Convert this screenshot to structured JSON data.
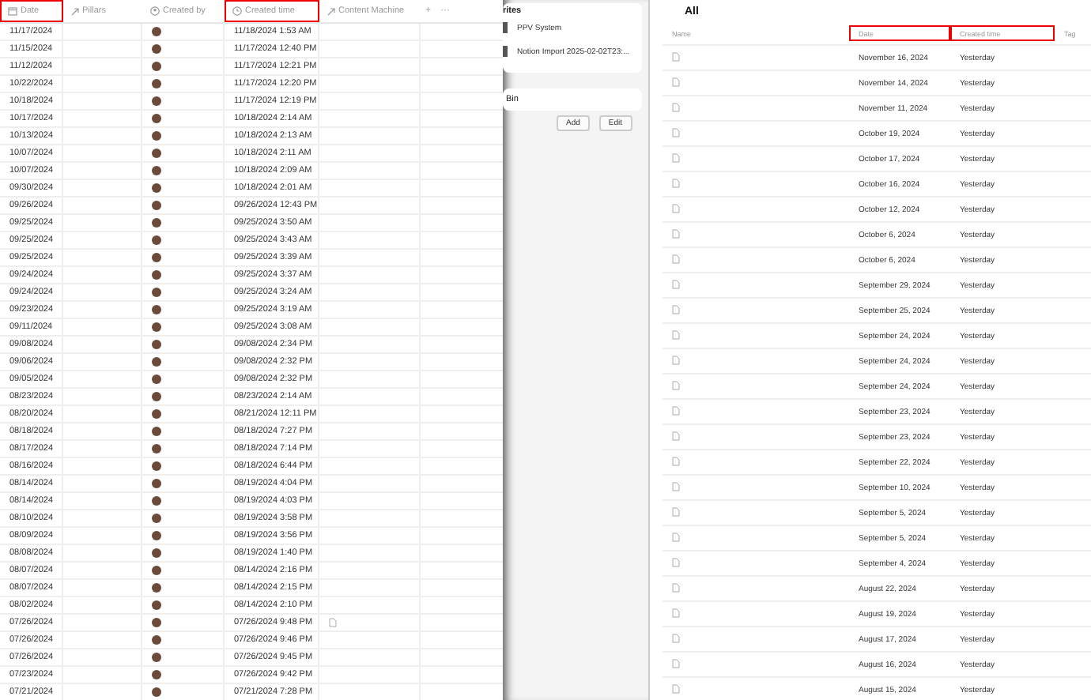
{
  "table": {
    "columns": [
      {
        "label": "Date",
        "highlighted": true
      },
      {
        "label": "Pillars",
        "highlighted": false
      },
      {
        "label": "Created by",
        "highlighted": false
      },
      {
        "label": "Created time",
        "highlighted": true
      },
      {
        "label": "Content Machine",
        "highlighted": false
      }
    ],
    "add_button": "+",
    "more_button": "···",
    "rows": [
      {
        "date": "11/17/2024",
        "created_time": "11/18/2024 1:53 AM",
        "page_link": false
      },
      {
        "date": "11/15/2024",
        "created_time": "11/17/2024 12:40 PM",
        "page_link": false
      },
      {
        "date": "11/12/2024",
        "created_time": "11/17/2024 12:21 PM",
        "page_link": false
      },
      {
        "date": "10/22/2024",
        "created_time": "11/17/2024 12:20 PM",
        "page_link": false
      },
      {
        "date": "10/18/2024",
        "created_time": "11/17/2024 12:19 PM",
        "page_link": false
      },
      {
        "date": "10/17/2024",
        "created_time": "10/18/2024 2:14 AM",
        "page_link": false
      },
      {
        "date": "10/13/2024",
        "created_time": "10/18/2024 2:13 AM",
        "page_link": false
      },
      {
        "date": "10/07/2024",
        "created_time": "10/18/2024 2:11 AM",
        "page_link": false
      },
      {
        "date": "10/07/2024",
        "created_time": "10/18/2024 2:09 AM",
        "page_link": false
      },
      {
        "date": "09/30/2024",
        "created_time": "10/18/2024 2:01 AM",
        "page_link": false
      },
      {
        "date": "09/26/2024",
        "created_time": "09/26/2024 12:43 PM",
        "page_link": false
      },
      {
        "date": "09/25/2024",
        "created_time": "09/25/2024 3:50 AM",
        "page_link": false
      },
      {
        "date": "09/25/2024",
        "created_time": "09/25/2024 3:43 AM",
        "page_link": false
      },
      {
        "date": "09/25/2024",
        "created_time": "09/25/2024 3:39 AM",
        "page_link": false
      },
      {
        "date": "09/24/2024",
        "created_time": "09/25/2024 3:37 AM",
        "page_link": false
      },
      {
        "date": "09/24/2024",
        "created_time": "09/25/2024 3:24 AM",
        "page_link": false
      },
      {
        "date": "09/23/2024",
        "created_time": "09/25/2024 3:19 AM",
        "page_link": false
      },
      {
        "date": "09/11/2024",
        "created_time": "09/25/2024 3:08 AM",
        "page_link": false
      },
      {
        "date": "09/08/2024",
        "created_time": "09/08/2024 2:34 PM",
        "page_link": false
      },
      {
        "date": "09/06/2024",
        "created_time": "09/08/2024 2:32 PM",
        "page_link": false
      },
      {
        "date": "09/05/2024",
        "created_time": "09/08/2024 2:32 PM",
        "page_link": false
      },
      {
        "date": "08/23/2024",
        "created_time": "08/23/2024 2:14 AM",
        "page_link": false
      },
      {
        "date": "08/20/2024",
        "created_time": "08/21/2024 12:11 PM",
        "page_link": false
      },
      {
        "date": "08/18/2024",
        "created_time": "08/18/2024 7:27 PM",
        "page_link": false
      },
      {
        "date": "08/17/2024",
        "created_time": "08/18/2024 7:14 PM",
        "page_link": false
      },
      {
        "date": "08/16/2024",
        "created_time": "08/18/2024 6:44 PM",
        "page_link": false
      },
      {
        "date": "08/14/2024",
        "created_time": "08/19/2024 4:04 PM",
        "page_link": false
      },
      {
        "date": "08/14/2024",
        "created_time": "08/19/2024 4:03 PM",
        "page_link": false
      },
      {
        "date": "08/10/2024",
        "created_time": "08/19/2024 3:58 PM",
        "page_link": false
      },
      {
        "date": "08/09/2024",
        "created_time": "08/19/2024 3:56 PM",
        "page_link": false
      },
      {
        "date": "08/08/2024",
        "created_time": "08/19/2024 1:40 PM",
        "page_link": false
      },
      {
        "date": "08/07/2024",
        "created_time": "08/14/2024 2:16 PM",
        "page_link": false
      },
      {
        "date": "08/07/2024",
        "created_time": "08/14/2024 2:15 PM",
        "page_link": false
      },
      {
        "date": "08/02/2024",
        "created_time": "08/14/2024 2:10 PM",
        "page_link": false
      },
      {
        "date": "07/26/2024",
        "created_time": "07/26/2024 9:48 PM",
        "page_link": true
      },
      {
        "date": "07/26/2024",
        "created_time": "07/26/2024 9:46 PM",
        "page_link": false
      },
      {
        "date": "07/26/2024",
        "created_time": "07/26/2024 9:45 PM",
        "page_link": false
      },
      {
        "date": "07/23/2024",
        "created_time": "07/26/2024 9:42 PM",
        "page_link": false
      },
      {
        "date": "07/21/2024",
        "created_time": "07/21/2024 7:28 PM",
        "page_link": false
      }
    ]
  },
  "sidebar": {
    "section_title": "rites",
    "items": [
      "PPV System",
      "Notion Import 2025-02-02T23:..."
    ],
    "bin_label": "Bin",
    "buttons": [
      "Add",
      "Edit"
    ]
  },
  "list": {
    "title": "All",
    "columns": [
      {
        "label": "Name",
        "highlighted": false
      },
      {
        "label": "Date",
        "highlighted": true
      },
      {
        "label": "Created time",
        "highlighted": true
      },
      {
        "label": "Tag",
        "highlighted": false
      }
    ],
    "rows": [
      {
        "date": "November 16, 2024",
        "created_time": "Yesterday"
      },
      {
        "date": "November 14, 2024",
        "created_time": "Yesterday"
      },
      {
        "date": "November 11, 2024",
        "created_time": "Yesterday"
      },
      {
        "date": "October 19, 2024",
        "created_time": "Yesterday"
      },
      {
        "date": "October 17, 2024",
        "created_time": "Yesterday"
      },
      {
        "date": "October 16, 2024",
        "created_time": "Yesterday"
      },
      {
        "date": "October 12, 2024",
        "created_time": "Yesterday"
      },
      {
        "date": "October 6, 2024",
        "created_time": "Yesterday"
      },
      {
        "date": "October 6, 2024",
        "created_time": "Yesterday"
      },
      {
        "date": "September 29, 2024",
        "created_time": "Yesterday"
      },
      {
        "date": "September 25, 2024",
        "created_time": "Yesterday"
      },
      {
        "date": "September 24, 2024",
        "created_time": "Yesterday"
      },
      {
        "date": "September 24, 2024",
        "created_time": "Yesterday"
      },
      {
        "date": "September 24, 2024",
        "created_time": "Yesterday"
      },
      {
        "date": "September 23, 2024",
        "created_time": "Yesterday"
      },
      {
        "date": "September 23, 2024",
        "created_time": "Yesterday"
      },
      {
        "date": "September 22, 2024",
        "created_time": "Yesterday"
      },
      {
        "date": "September 10, 2024",
        "created_time": "Yesterday"
      },
      {
        "date": "September 5, 2024",
        "created_time": "Yesterday"
      },
      {
        "date": "September 5, 2024",
        "created_time": "Yesterday"
      },
      {
        "date": "September 4, 2024",
        "created_time": "Yesterday"
      },
      {
        "date": "August 22, 2024",
        "created_time": "Yesterday"
      },
      {
        "date": "August 19, 2024",
        "created_time": "Yesterday"
      },
      {
        "date": "August 17, 2024",
        "created_time": "Yesterday"
      },
      {
        "date": "August 16, 2024",
        "created_time": "Yesterday"
      },
      {
        "date": "August 15, 2024",
        "created_time": "Yesterday"
      }
    ]
  }
}
